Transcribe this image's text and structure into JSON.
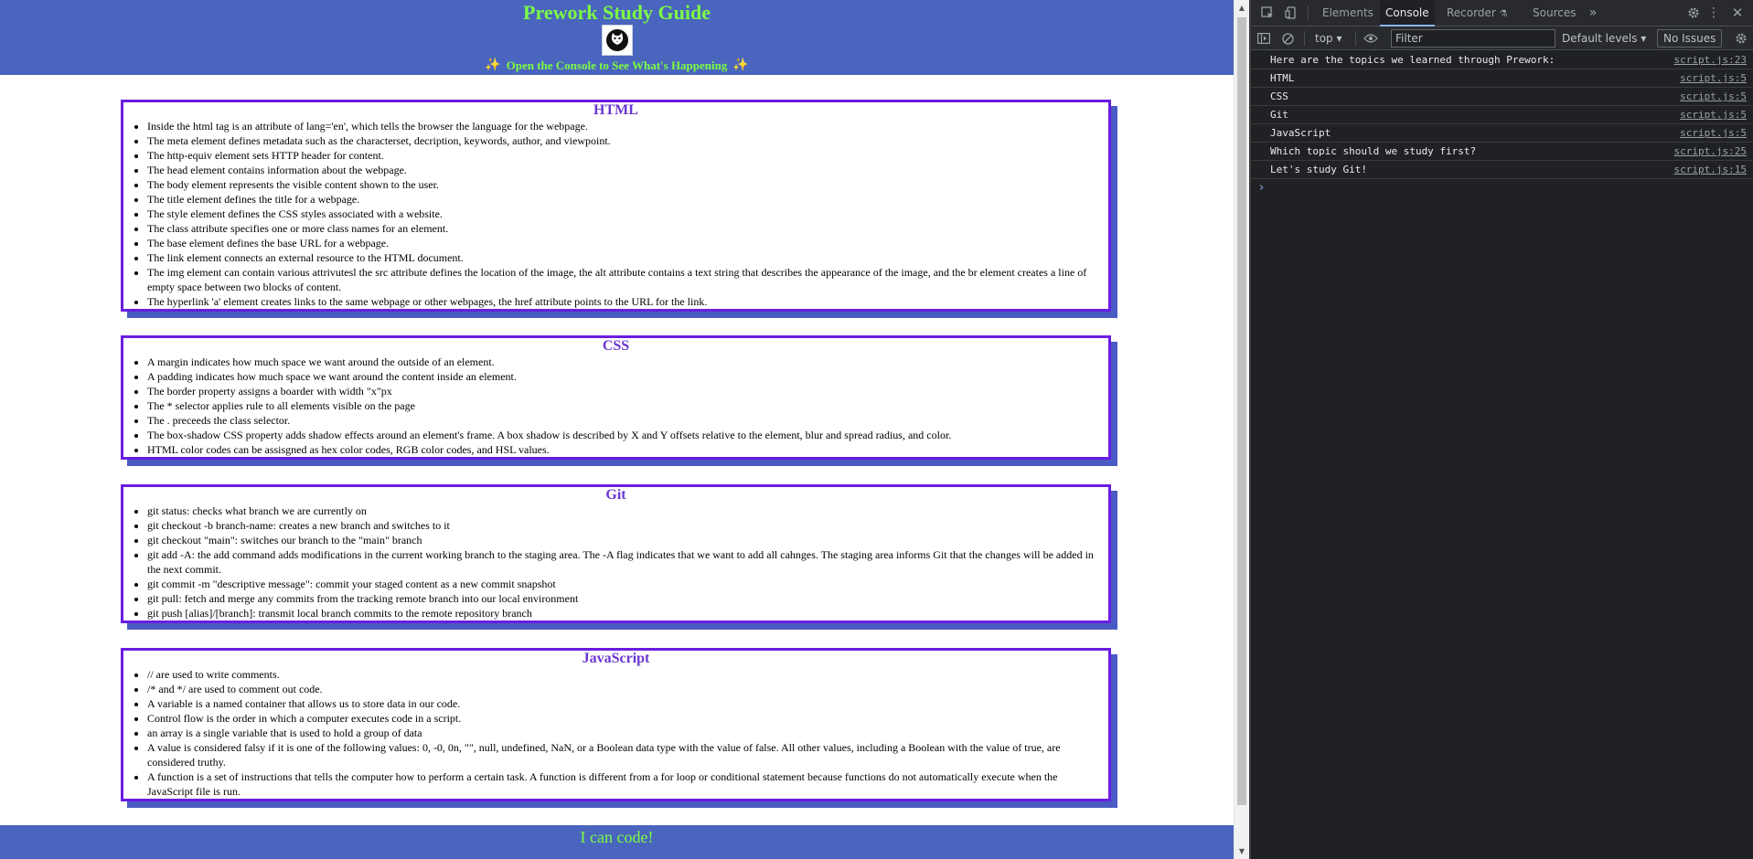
{
  "page": {
    "title": "Prework Study Guide",
    "hint": "Open the Console to See What's Happening",
    "sections": [
      {
        "heading": "HTML",
        "items": [
          "Inside the html tag is an attribute of lang='en', which tells the browser the language for the webpage.",
          "The meta element defines metadata such as the characterset, decription, keywords, author, and viewpoint.",
          "The http-equiv element sets HTTP header for content.",
          "The head element contains information about the webpage.",
          "The body element represents the visible content shown to the user.",
          "The title element defines the title for a webpage.",
          "The style element defines the CSS styles associated with a website.",
          "The class attribute specifies one or more class names for an element.",
          "The base element defines the base URL for a webpage.",
          "The link element connects an external resource to the HTML document.",
          "The img element can contain various attrivutesl the src attribute defines the location of the image, the alt attribute contains a text string that describes the appearance of the image, and the br element creates a line of empty space between two blocks of content.",
          "The hyperlink 'a' element creates links to the same webpage or other webpages, the href attribute points to the URL for the link."
        ]
      },
      {
        "heading": "CSS",
        "items": [
          "A margin indicates how much space we want around the outside of an element.",
          "A padding indicates how much space we want around the content inside an element.",
          "The border property assigns a boarder with width \"x\"px",
          "The * selector applies rule to all elements visible on the page",
          "The . preceeds the class selector.",
          "The box-shadow CSS property adds shadow effects around an element's frame. A box shadow is described by X and Y offsets relative to the element, blur and spread radius, and color.",
          "HTML color codes can be assisgned as hex color codes, RGB color codes, and HSL values."
        ]
      },
      {
        "heading": "Git",
        "items": [
          "git status: checks what branch we are currently on",
          "git checkout -b branch-name: creates a new branch and switches to it",
          "git checkout \"main\": switches our branch to the \"main\" branch",
          "git add -A: the add command adds modifications in the current working branch to the staging area. The -A flag indicates that we want to add all cahnges. The staging area informs Git that the changes will be added in the next commit.",
          "git commit -m \"descriptive message\": commit your staged content as a new commit snapshot",
          "git pull: fetch and merge any commits from the tracking remote branch into our local environment",
          "git push [alias]/[branch]: transmit local branch commits to the remote repository branch"
        ]
      },
      {
        "heading": "JavaScript",
        "items": [
          "// are used to write comments.",
          "/* and */ are used to comment out code.",
          "A variable is a named container that allows us to store data in our code.",
          "Control flow is the order in which a computer executes code in a script.",
          "an array is a single variable that is used to hold a group of data",
          "A value is considered falsy if it is one of the following values: 0, -0, 0n, \"\", null, undefined, NaN, or a Boolean data type with the value of false. All other values, including a Boolean with the value of true, are considered truthy.",
          "A function is a set of instructions that tells the computer how to perform a certain task. A function is different from a for loop or conditional statement because functions do not automatically execute when the JavaScript file is run."
        ]
      }
    ],
    "footer": "I can code!"
  },
  "devtools": {
    "tabs": [
      "Elements",
      "Console",
      "Recorder",
      "Sources"
    ],
    "context": "top",
    "filter_placeholder": "Filter",
    "levels": "Default levels",
    "issues": "No Issues",
    "messages": [
      {
        "text": "Here are the topics we learned through Prework:",
        "source": "script.js:23"
      },
      {
        "text": "HTML",
        "source": "script.js:5"
      },
      {
        "text": "CSS",
        "source": "script.js:5"
      },
      {
        "text": "Git",
        "source": "script.js:5"
      },
      {
        "text": "JavaScript",
        "source": "script.js:5"
      },
      {
        "text": "Which topic should we study first?",
        "source": "script.js:25"
      },
      {
        "text": "Let's study Git!",
        "source": "script.js:15"
      }
    ]
  },
  "colors": {
    "header_bg": "#4a65bd",
    "title_green": "#7cfc44",
    "card_border": "#6a1de0",
    "card_heading": "#6a36d0",
    "devtools_bg": "#202124"
  }
}
